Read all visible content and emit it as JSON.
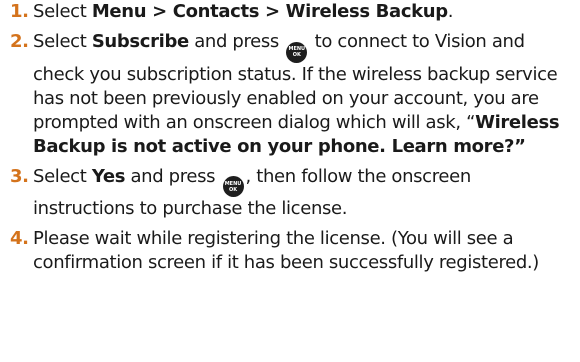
{
  "steps": [
    {
      "number": "1.",
      "text1": "Select ",
      "bold1": "Menu > Contacts > Wireless Backup",
      "text2": "."
    },
    {
      "number": "2.",
      "text1": "Select ",
      "bold1": "Subscribe",
      "text2": " and press ",
      "text3": " to connect to Vision and check you subscription status. If the wireless backup service has not been previously enabled on your account, you are prompted with an onscreen dialog which will ask, “",
      "bold2": "Wireless Backup is not active on your phone. Learn more?”"
    },
    {
      "number": "3.",
      "text1": "Select ",
      "bold1": "Yes",
      "text2": " and press ",
      "text3": ", then follow the onscreen instructions to purchase the license."
    },
    {
      "number": "4.",
      "text1": "Please wait while registering the license. (You will see a confirmation screen if it has been successfully registered.)"
    }
  ],
  "menu_key": {
    "icon": "menu-ok-key-icon",
    "top_label": "MENU",
    "bottom_label": "OK"
  },
  "colors": {
    "number": "#d4731c",
    "text": "#1a1a1a",
    "key_bg": "#1e1e1e"
  }
}
